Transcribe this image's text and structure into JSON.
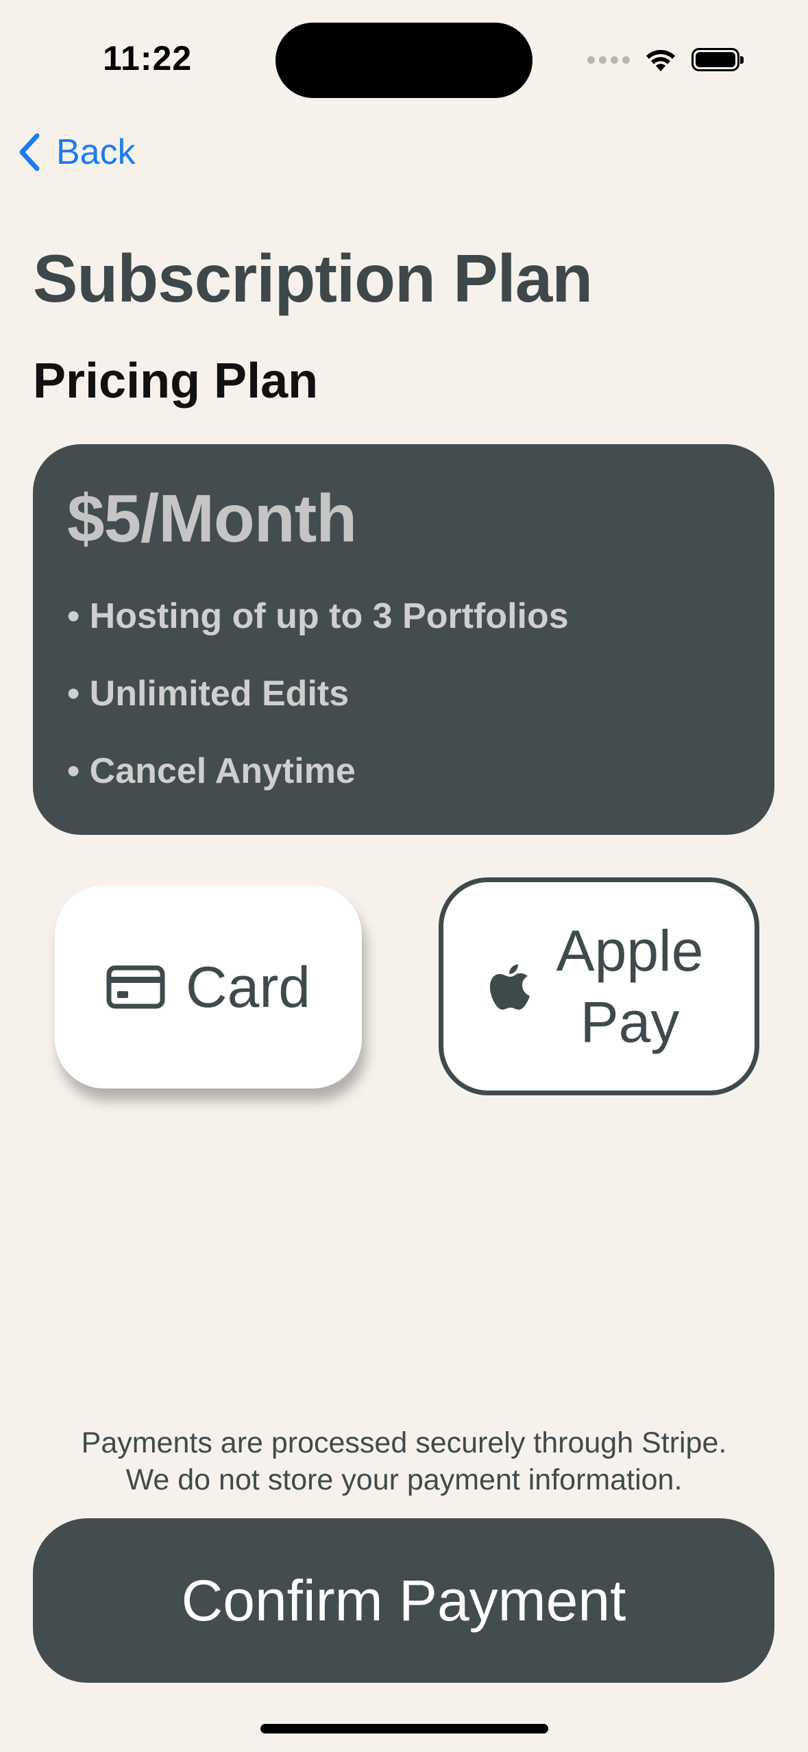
{
  "status_bar": {
    "time": "11:22"
  },
  "nav": {
    "back_label": "Back"
  },
  "page": {
    "title": "Subscription Plan",
    "section_title": "Pricing Plan"
  },
  "plan": {
    "price": "$5/Month",
    "features": [
      "Hosting of up to 3 Portfolios",
      "Unlimited Edits",
      "Cancel Anytime"
    ]
  },
  "payment_methods": {
    "card_label": "Card",
    "apple_pay_label": "Apple Pay",
    "selected": "Apple Pay"
  },
  "notice": {
    "line1": "Payments are processed securely through Stripe.",
    "line2": "We do not store your payment information."
  },
  "confirm": {
    "label": "Confirm Payment"
  },
  "colors": {
    "background": "#f6f2eb",
    "dark": "#434c4e",
    "accent_link": "#1a7cf0"
  },
  "icons": {
    "back": "chevron-left-icon",
    "card": "credit-card-icon",
    "apple": "apple-logo-icon",
    "wifi": "wifi-icon",
    "battery": "battery-icon"
  }
}
